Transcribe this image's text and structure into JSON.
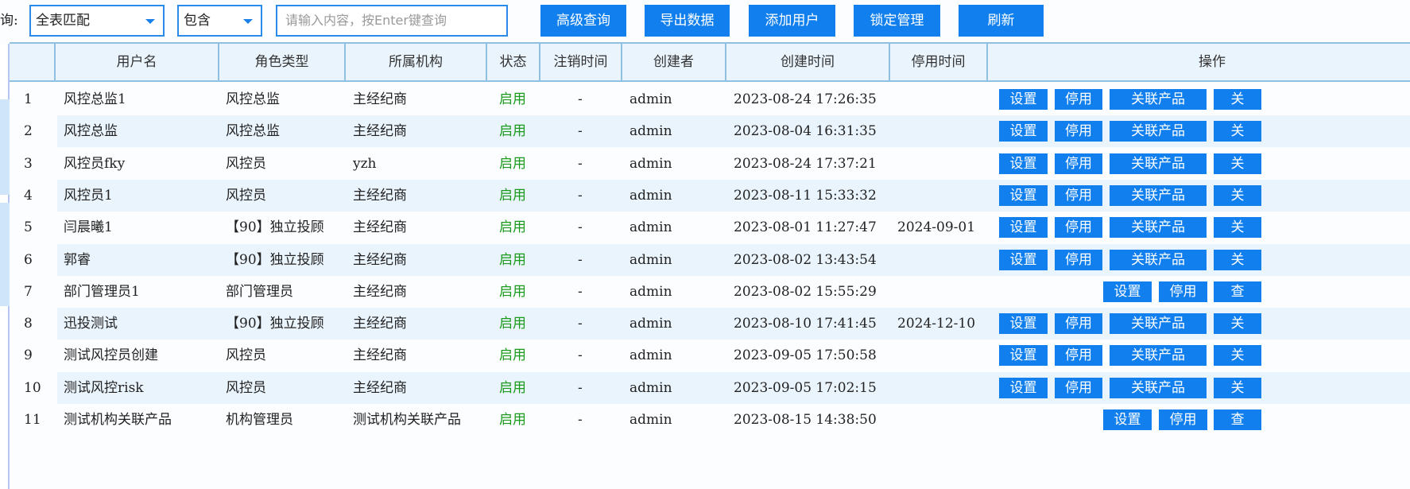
{
  "toolbar": {
    "query_label": "询:",
    "match_select": "全表匹配",
    "op_select": "包含",
    "search_placeholder": "请输入内容，按Enter键查询",
    "buttons": [
      "高级查询",
      "导出数据",
      "添加用户",
      "锁定管理",
      "刷新"
    ]
  },
  "table": {
    "headers": [
      "",
      "用户名",
      "角色类型",
      "所属机构",
      "状态",
      "注销时间",
      "创建者",
      "创建时间",
      "停用时间",
      "操作"
    ],
    "rows": [
      {
        "idx": "1",
        "name": "风控总监1",
        "role": "风控总监",
        "org": "主经纪商",
        "status": "启用",
        "cancel": "-",
        "creator": "admin",
        "created": "2023-08-24 17:26:35",
        "disabled": "",
        "actions": [
          "设置",
          "停用",
          "关联产品",
          "关"
        ]
      },
      {
        "idx": "2",
        "name": "风控总监",
        "role": "风控总监",
        "org": "主经纪商",
        "status": "启用",
        "cancel": "-",
        "creator": "admin",
        "created": "2023-08-04 16:31:35",
        "disabled": "",
        "actions": [
          "设置",
          "停用",
          "关联产品",
          "关"
        ]
      },
      {
        "idx": "3",
        "name": "风控员fky",
        "role": "风控员",
        "org": "yzh",
        "status": "启用",
        "cancel": "-",
        "creator": "admin",
        "created": "2023-08-24 17:37:21",
        "disabled": "",
        "actions": [
          "设置",
          "停用",
          "关联产品",
          "关"
        ]
      },
      {
        "idx": "4",
        "name": "风控员1",
        "role": "风控员",
        "org": "主经纪商",
        "status": "启用",
        "cancel": "-",
        "creator": "admin",
        "created": "2023-08-11 15:33:32",
        "disabled": "",
        "actions": [
          "设置",
          "停用",
          "关联产品",
          "关"
        ]
      },
      {
        "idx": "5",
        "name": "闫晨曦1",
        "role": "【90】独立投顾",
        "org": "主经纪商",
        "status": "启用",
        "cancel": "-",
        "creator": "admin",
        "created": "2023-08-01 11:27:47",
        "disabled": "2024-09-01",
        "actions": [
          "设置",
          "停用",
          "关联产品",
          "关"
        ]
      },
      {
        "idx": "6",
        "name": "郭睿",
        "role": "【90】独立投顾",
        "org": "主经纪商",
        "status": "启用",
        "cancel": "-",
        "creator": "admin",
        "created": "2023-08-02 13:43:54",
        "disabled": "",
        "actions": [
          "设置",
          "停用",
          "关联产品",
          "关"
        ]
      },
      {
        "idx": "7",
        "name": "部门管理员1",
        "role": "部门管理员",
        "org": "主经纪商",
        "status": "启用",
        "cancel": "-",
        "creator": "admin",
        "created": "2023-08-02 15:55:29",
        "disabled": "",
        "actions": [
          "设置",
          "停用",
          "查"
        ]
      },
      {
        "idx": "8",
        "name": "迅投测试",
        "role": "【90】独立投顾",
        "org": "主经纪商",
        "status": "启用",
        "cancel": "-",
        "creator": "admin",
        "created": "2023-08-10 17:41:45",
        "disabled": "2024-12-10",
        "actions": [
          "设置",
          "停用",
          "关联产品",
          "关"
        ]
      },
      {
        "idx": "9",
        "name": "测试风控员创建",
        "role": "风控员",
        "org": "主经纪商",
        "status": "启用",
        "cancel": "-",
        "creator": "admin",
        "created": "2023-09-05 17:50:58",
        "disabled": "",
        "actions": [
          "设置",
          "停用",
          "关联产品",
          "关"
        ]
      },
      {
        "idx": "10",
        "name": "测试风控risk",
        "role": "风控员",
        "org": "主经纪商",
        "status": "启用",
        "cancel": "-",
        "creator": "admin",
        "created": "2023-09-05 17:02:15",
        "disabled": "",
        "actions": [
          "设置",
          "停用",
          "关联产品",
          "关"
        ]
      },
      {
        "idx": "11",
        "name": "测试机构关联产品",
        "role": "机构管理员",
        "org": "测试机构关联产品",
        "status": "启用",
        "cancel": "-",
        "creator": "admin",
        "created": "2023-08-15 14:38:50",
        "disabled": "",
        "actions": [
          "设置",
          "停用",
          "查"
        ]
      }
    ]
  },
  "colors": {
    "accent": "#1180ee",
    "status_enabled": "#1a9a1a",
    "header_bg": "#eaf4fd"
  }
}
